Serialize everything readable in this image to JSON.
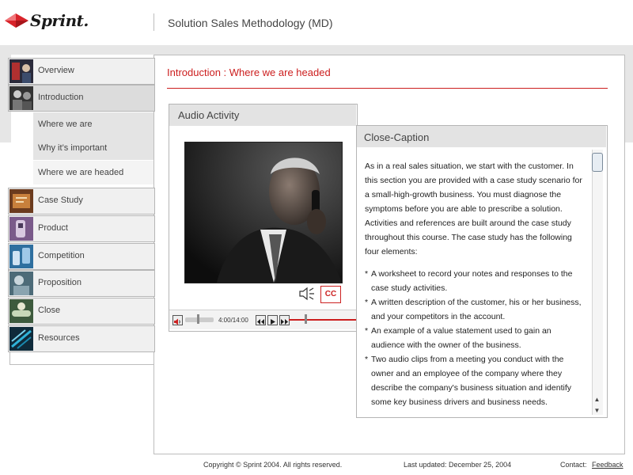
{
  "header": {
    "logo_text": "Sprint.",
    "app_title": "Solution Sales Methodology (MD)"
  },
  "sidebar": {
    "items": [
      {
        "label": "Overview"
      },
      {
        "label": "Introduction"
      },
      {
        "label": "Case Study"
      },
      {
        "label": "Product"
      },
      {
        "label": "Competition"
      },
      {
        "label": "Proposition"
      },
      {
        "label": "Close"
      },
      {
        "label": "Resources"
      }
    ],
    "subitems": [
      {
        "label": "Where we are"
      },
      {
        "label": "Why it’s important"
      },
      {
        "label": "Where we are headed"
      }
    ],
    "active_item": "Introduction",
    "current_subitem": "Where we are headed"
  },
  "main": {
    "section_title": "Introduction : Where we are headed"
  },
  "audio": {
    "title": "Audio Activity",
    "cc_button_label": "CC",
    "time": "4:00/14:00",
    "progress": 0.25,
    "volume": 0.45
  },
  "caption": {
    "title": "Close-Caption",
    "intro": "As in a real sales situation, we start with the customer. In this section you are provided with a case study scenario for a small-high-growth business. You must diagnose the symptoms before you are able to prescribe a solution.  Activities and references are built around the case study throughout this course. The case study has the following four elements:",
    "bullets": [
      "A worksheet to record your notes and responses to the case study activities.",
      "A written description of the customer, his or her business, and your competitors in the account.",
      "An example of a value statement used to gain an audience with the owner of the business.",
      "Two audio clips from a meeting you conduct with the owner and an employee of the company where they describe the company's business situation and identify some key business drivers and business needs."
    ]
  },
  "footer": {
    "copyright": "Copyright © Sprint 2004. All rights reserved.",
    "last_updated": "Last  updated: December 25, 2004",
    "contact_label": "Contact:",
    "feedback_label": "Feedback"
  },
  "colors": {
    "accent_red": "#cc1e1e",
    "panel_header": "#e3e3e3",
    "nav_bg": "#f0f0f0"
  }
}
